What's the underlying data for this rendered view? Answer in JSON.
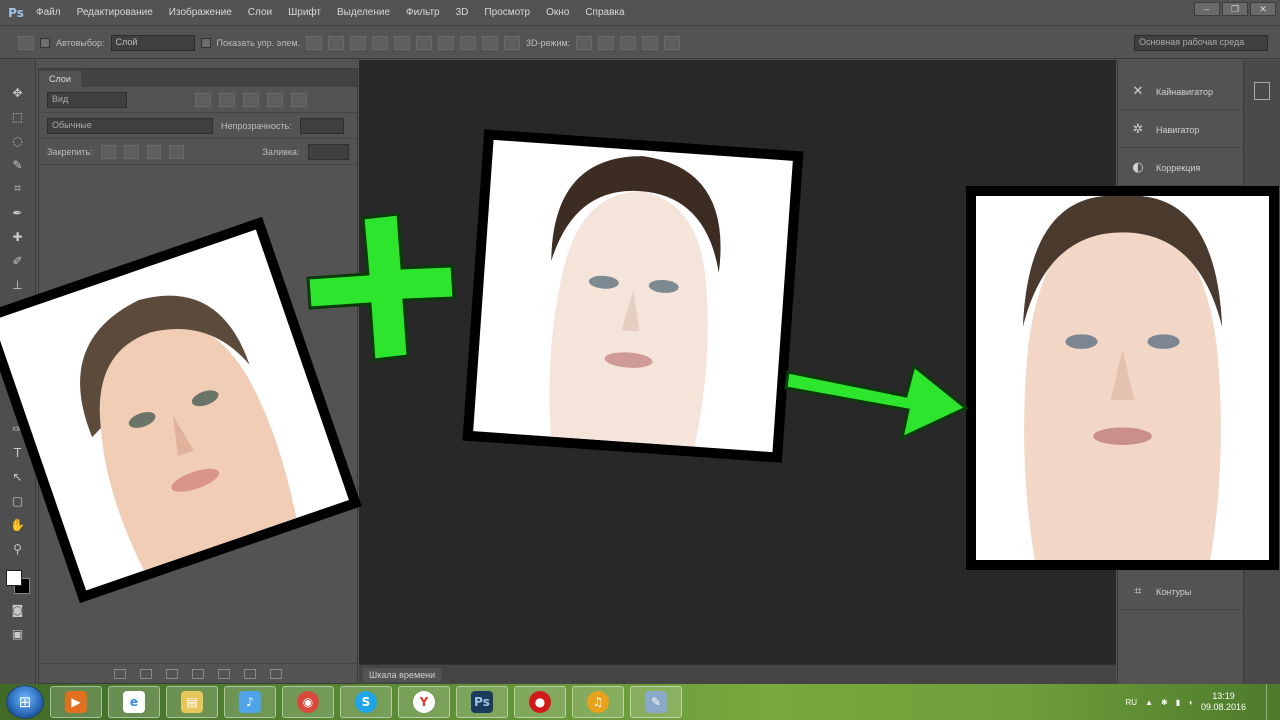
{
  "menu": {
    "logo": "Ps",
    "items": [
      "Файл",
      "Редактирование",
      "Изображение",
      "Слои",
      "Шрифт",
      "Выделение",
      "Фильтр",
      "3D",
      "Просмотр",
      "Окно",
      "Справка"
    ]
  },
  "options_bar": {
    "autoselect_label": "Автовыбор:",
    "autoselect_value": "Слой",
    "show_controls_label": "Показать упр. элем.",
    "mode_3d_label": "3D-режим:",
    "workspace_value": "Основная рабочая среда"
  },
  "layers_panel": {
    "tab_label": "Слои",
    "filter_value": "Вид",
    "blend_mode": "Обычные",
    "opacity_label": "Непрозрачность:",
    "lock_label": "Закрепить:",
    "fill_label": "Заливка:"
  },
  "right_dock": {
    "items": [
      {
        "label": "Кайнавигатор",
        "icon": "navigator-icon"
      },
      {
        "label": "Навигатор",
        "icon": "navigator-compass-icon"
      },
      {
        "label": "Коррекция",
        "icon": "adjustments-icon"
      },
      {
        "label": "Контуры",
        "icon": "paths-icon"
      }
    ]
  },
  "timeline": {
    "tab_label": "Шкала времени"
  },
  "overlay": {
    "plus_color": "#2ee52e",
    "arrow_color": "#2ee52e"
  },
  "taskbar": {
    "buttons": [
      {
        "name": "media-player",
        "icon": "media-player-icon",
        "color": "#e0701f"
      },
      {
        "name": "internet-explorer",
        "icon": "ie-icon",
        "color": "#2f8fe0"
      },
      {
        "name": "file-explorer",
        "icon": "folder-icon",
        "color": "#e8c75a"
      },
      {
        "name": "sound",
        "icon": "sound-icon",
        "color": "#4fa3e8"
      },
      {
        "name": "chrome",
        "icon": "chrome-icon",
        "color": "#d94a3c"
      },
      {
        "name": "skype",
        "icon": "skype-icon",
        "color": "#1ea4e8"
      },
      {
        "name": "yandex",
        "icon": "yandex-icon",
        "color": "#e5322d"
      },
      {
        "name": "photoshop",
        "icon": "photoshop-icon",
        "color": "#1c3a5a",
        "text": "Ps"
      },
      {
        "name": "recorder",
        "icon": "record-icon",
        "color": "#d11b1b"
      },
      {
        "name": "aimp",
        "icon": "headphones-icon",
        "color": "#e8a11a"
      },
      {
        "name": "paint",
        "icon": "paint-icon",
        "color": "#8aa9c8"
      }
    ],
    "tray_lang": "RU",
    "clock_time": "13:19",
    "clock_date": "09.08.2016"
  }
}
